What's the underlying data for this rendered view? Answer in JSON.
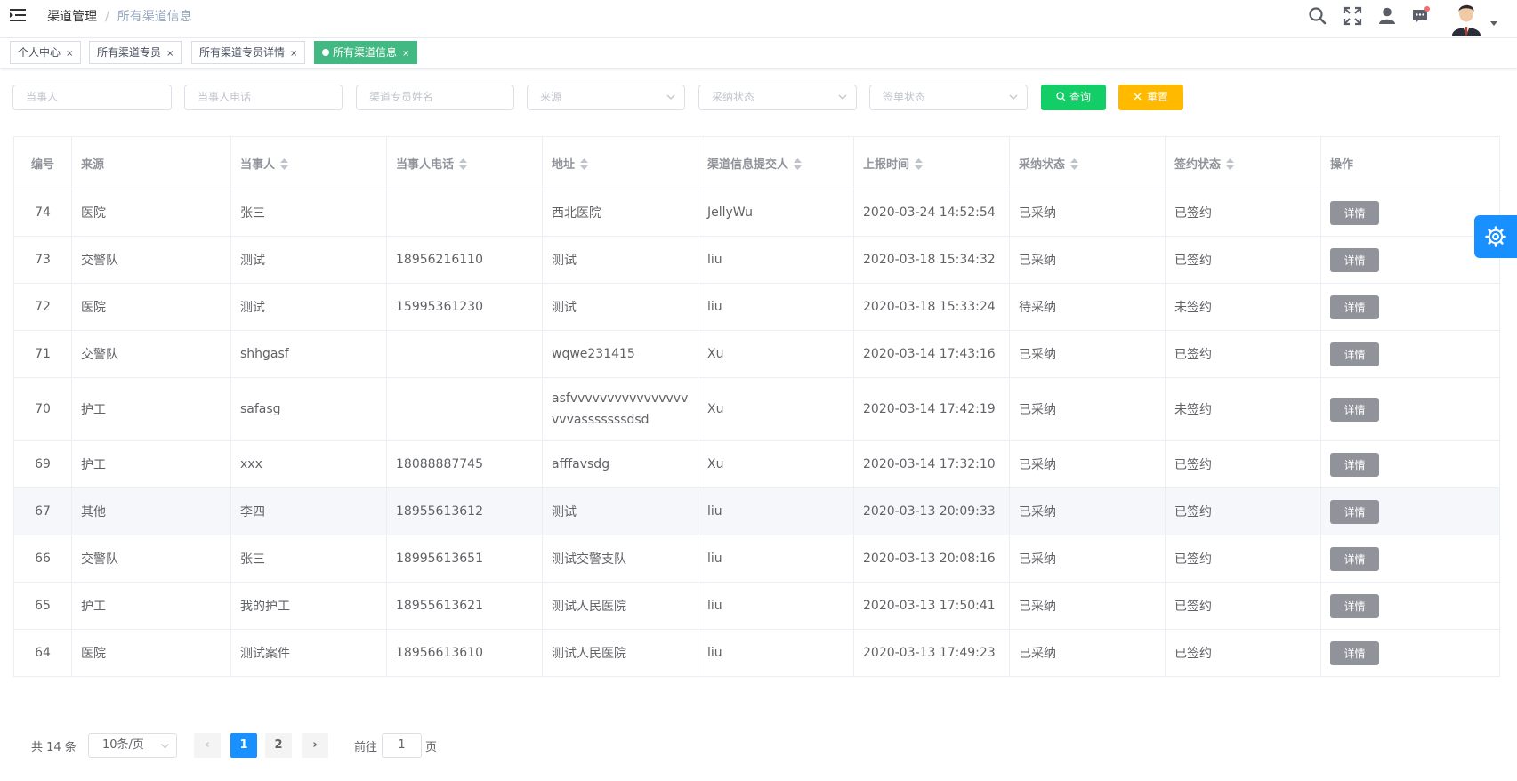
{
  "breadcrumb": {
    "level1": "渠道管理",
    "separator": "/",
    "level2": "所有渠道信息"
  },
  "navbar_icons": [
    "menu-fold-icon",
    "search-icon",
    "fullscreen-icon",
    "user-icon",
    "message-icon",
    "avatar"
  ],
  "tags": [
    {
      "label": "个人中心",
      "active": false
    },
    {
      "label": "所有渠道专员",
      "active": false
    },
    {
      "label": "所有渠道专员详情",
      "active": false
    },
    {
      "label": "所有渠道信息",
      "active": true
    }
  ],
  "tag_close": "×",
  "filters": {
    "party_placeholder": "当事人",
    "party_phone_placeholder": "当事人电话",
    "agent_name_placeholder": "渠道专员姓名",
    "source_placeholder": "来源",
    "adopt_status_placeholder": "采纳状态",
    "sign_status_placeholder": "签单状态",
    "search_label": "查询",
    "reset_label": "重置"
  },
  "table": {
    "headers": [
      "编号",
      "来源",
      "当事人",
      "当事人电话",
      "地址",
      "渠道信息提交人",
      "上报时间",
      "采纳状态",
      "签约状态",
      "操作"
    ],
    "detail_label": "详情",
    "rows": [
      {
        "id": "74",
        "source": "医院",
        "party": "张三",
        "phone": "",
        "address": "西北医院",
        "submitter": "JellyWu",
        "time": "2020-03-24 14:52:54",
        "adopt": "已采纳",
        "sign": "已签约"
      },
      {
        "id": "73",
        "source": "交警队",
        "party": "测试",
        "phone": "18956216110",
        "address": "测试",
        "submitter": "liu",
        "time": "2020-03-18 15:34:32",
        "adopt": "已采纳",
        "sign": "已签约"
      },
      {
        "id": "72",
        "source": "医院",
        "party": "测试",
        "phone": "15995361230",
        "address": "测试",
        "submitter": "liu",
        "time": "2020-03-18 15:33:24",
        "adopt": "待采纳",
        "sign": "未签约"
      },
      {
        "id": "71",
        "source": "交警队",
        "party": "shhgasf",
        "phone": "",
        "address": "wqwe231415",
        "submitter": "Xu",
        "time": "2020-03-14 17:43:16",
        "adopt": "已采纳",
        "sign": "已签约"
      },
      {
        "id": "70",
        "source": "护工",
        "party": "safasg",
        "phone": "",
        "address": "asfvvvvvvvvvvvvvvvvvvvasssssssdsd",
        "submitter": "Xu",
        "time": "2020-03-14 17:42:19",
        "adopt": "已采纳",
        "sign": "未签约"
      },
      {
        "id": "69",
        "source": "护工",
        "party": "xxx",
        "phone": "18088887745",
        "address": "afffavsdg",
        "submitter": "Xu",
        "time": "2020-03-14 17:32:10",
        "adopt": "已采纳",
        "sign": "已签约"
      },
      {
        "id": "67",
        "source": "其他",
        "party": "李四",
        "phone": "18955613612",
        "address": "测试",
        "submitter": "liu",
        "time": "2020-03-13 20:09:33",
        "adopt": "已采纳",
        "sign": "已签约"
      },
      {
        "id": "66",
        "source": "交警队",
        "party": "张三",
        "phone": "18995613651",
        "address": "测试交警支队",
        "submitter": "liu",
        "time": "2020-03-13 20:08:16",
        "adopt": "已采纳",
        "sign": "已签约"
      },
      {
        "id": "65",
        "source": "护工",
        "party": "我的护工",
        "phone": "18955613621",
        "address": "测试人民医院",
        "submitter": "liu",
        "time": "2020-03-13 17:50:41",
        "adopt": "已采纳",
        "sign": "已签约"
      },
      {
        "id": "64",
        "source": "医院",
        "party": "测试案件",
        "phone": "18956613610",
        "address": "测试人民医院",
        "submitter": "liu",
        "time": "2020-03-13 17:49:23",
        "adopt": "已采纳",
        "sign": "已签约"
      }
    ]
  },
  "pagination": {
    "total_text": "共 14 条",
    "page_size": "10条/页",
    "pages": [
      "1",
      "2"
    ],
    "current_page": "1",
    "goto_label": "前往",
    "goto_value": "1",
    "page_suffix": "页",
    "prev_icon": "‹",
    "next_icon": "›"
  },
  "colors": {
    "primary": "#1890ff",
    "success": "#13ce66",
    "warning": "#ffba00",
    "tag_active": "#42b983",
    "info": "#909399"
  }
}
